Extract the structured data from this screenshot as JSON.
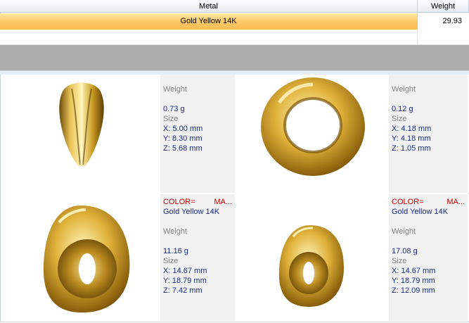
{
  "table": {
    "headers": {
      "metal": "Metal",
      "weight": "Weight"
    },
    "rows": [
      {
        "metal": "Gold Yellow 14K",
        "weight": "29.93"
      }
    ]
  },
  "labels": {
    "weight": "Weight",
    "size": "Size",
    "color_key": "COLOR=",
    "color_trunc": "MA..."
  },
  "items": [
    {
      "weight": "0.73 g",
      "x": "X: 5.00 mm",
      "y": "Y: 8.30 mm",
      "z": "Z: 5.68 mm"
    },
    {
      "weight": "0.12 g",
      "x": "X: 4.18 mm",
      "y": "Y: 4.18 mm",
      "z": "Z: 1.05 mm"
    },
    {
      "color": "Gold Yellow 14K",
      "weight": "11.16 g",
      "x": "X: 14.67 mm",
      "y": "Y: 18.79 mm",
      "z": "Z: 7.42 mm"
    },
    {
      "color": "Gold Yellow 14K",
      "weight": "17.08 g",
      "x": "X: 14.67 mm",
      "y": "Y: 18.79 mm",
      "z": "Z: 12.09 mm"
    }
  ]
}
